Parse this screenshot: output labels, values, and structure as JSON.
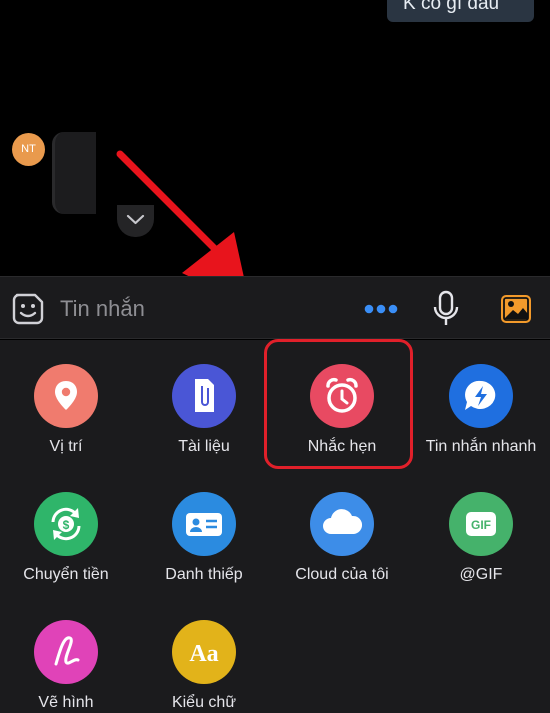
{
  "chat": {
    "sent_message": "K có gì đâu",
    "avatar_initials": "NT"
  },
  "composer": {
    "placeholder": "Tin nhắn",
    "emoji_icon": "sticker-face-icon",
    "more_icon": "more-dots-icon",
    "mic_icon": "microphone-icon",
    "photo_icon": "photo-gallery-icon"
  },
  "actions": [
    {
      "label": "Vị trí",
      "icon": "location-pin-icon",
      "color": "#f07b6e"
    },
    {
      "label": "Tài liệu",
      "icon": "paperclip-document-icon",
      "color": "#4a56d6"
    },
    {
      "label": "Nhắc hẹn",
      "icon": "alarm-clock-icon",
      "color": "#e84a62"
    },
    {
      "label": "Tin nhắn nhanh",
      "icon": "quick-message-bolt-icon",
      "color": "#1f6fe0"
    },
    {
      "label": "Chuyển tiền",
      "icon": "money-transfer-icon",
      "color": "#2fb56a"
    },
    {
      "label": "Danh thiếp",
      "icon": "business-card-icon",
      "color": "#2b8be0"
    },
    {
      "label": "Cloud của tôi",
      "icon": "cloud-icon",
      "color": "#3d8de8"
    },
    {
      "label": "@GIF",
      "icon": "gif-icon",
      "color": "#45b26b"
    },
    {
      "label": "Vẽ hình",
      "icon": "draw-scribble-icon",
      "color": "#e043b8"
    },
    {
      "label": "Kiểu chữ",
      "icon": "font-style-icon",
      "color": "#e2b31a"
    }
  ],
  "colors": {
    "highlight_box": "#e1202a",
    "annotation_arrow": "#e8141c",
    "accent_blue": "#3a8ef6",
    "photo_orange": "#f39a2b"
  }
}
